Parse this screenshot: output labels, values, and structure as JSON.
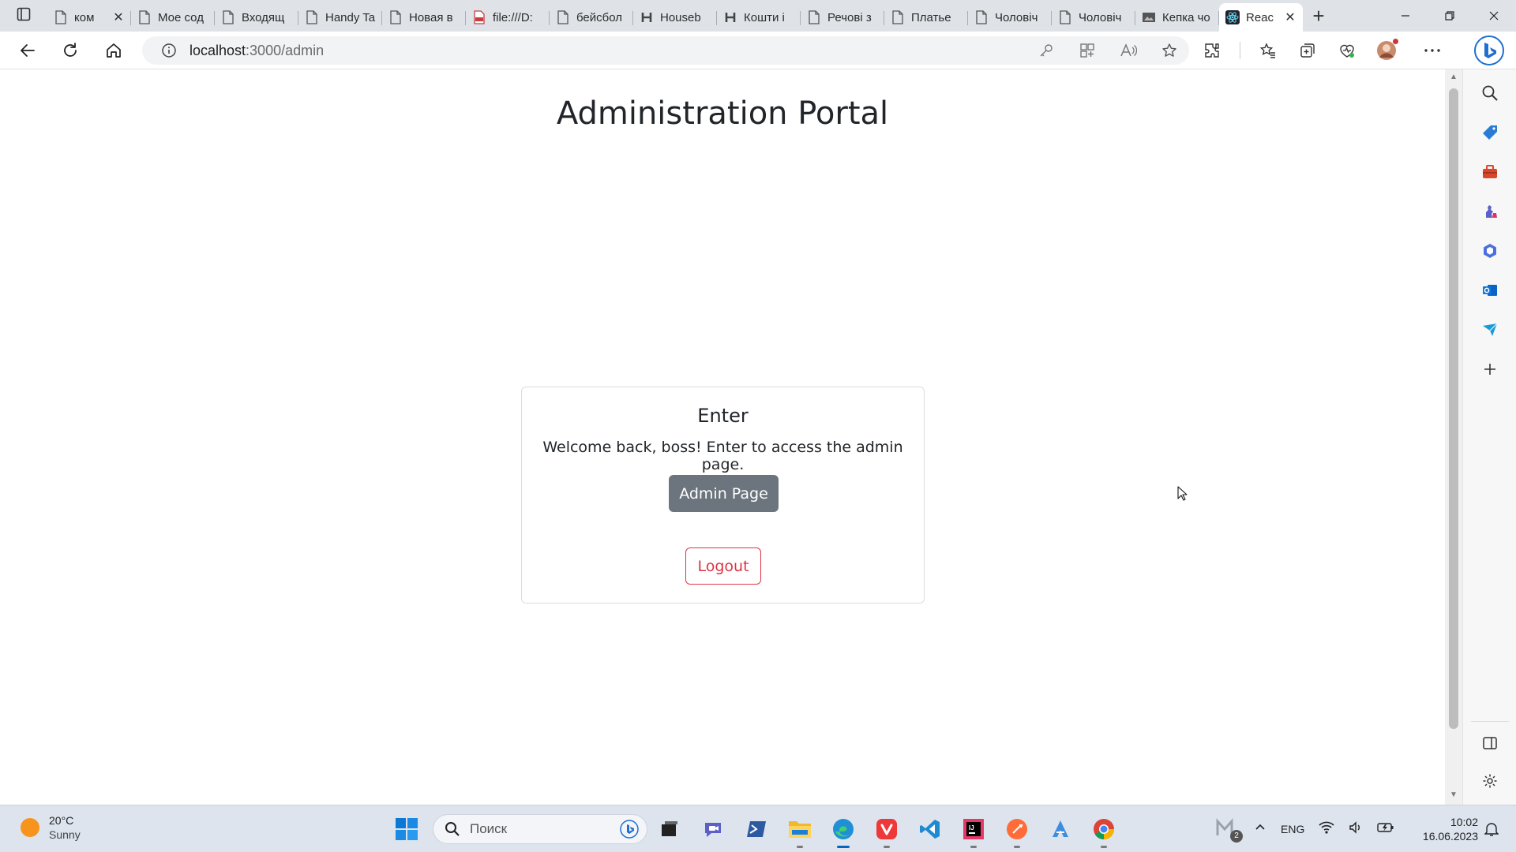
{
  "browser": {
    "tabs": [
      {
        "title": "ком",
        "icon": "page-icon",
        "closable": true
      },
      {
        "title": "Мое сод",
        "icon": "page-icon"
      },
      {
        "title": "Входящ",
        "icon": "page-icon"
      },
      {
        "title": "Handy Ta",
        "icon": "page-icon"
      },
      {
        "title": "Новая в",
        "icon": "page-icon"
      },
      {
        "title": "file:///D:",
        "icon": "pdf-icon"
      },
      {
        "title": "бейсбол",
        "icon": "page-icon"
      },
      {
        "title": "Houseb",
        "icon": "h-icon"
      },
      {
        "title": "Кошти і",
        "icon": "h-icon"
      },
      {
        "title": "Речові з",
        "icon": "page-icon"
      },
      {
        "title": "Платье",
        "icon": "page-icon"
      },
      {
        "title": "Чоловіч",
        "icon": "page-icon"
      },
      {
        "title": "Чоловіч",
        "icon": "page-icon"
      },
      {
        "title": "Кепка чо",
        "icon": "image-icon"
      },
      {
        "title": "Reac",
        "icon": "react-icon",
        "active": true
      }
    ],
    "address": {
      "host": "localhost",
      "path": ":3000/admin"
    }
  },
  "page": {
    "title": "Administration Portal",
    "card": {
      "title": "Enter",
      "text": "Welcome back, boss! Enter to access the admin page.",
      "admin_button": "Admin Page",
      "logout_button": "Logout"
    }
  },
  "taskbar": {
    "weather": {
      "temp": "20°C",
      "desc": "Sunny"
    },
    "search_placeholder": "Поиск",
    "language": "ENG",
    "time": "10:02",
    "date": "16.06.2023",
    "badge_count": "2"
  },
  "colors": {
    "admin_button": "#6c757d",
    "logout": "#dc3545",
    "tabstrip": "#dfe3e8"
  }
}
